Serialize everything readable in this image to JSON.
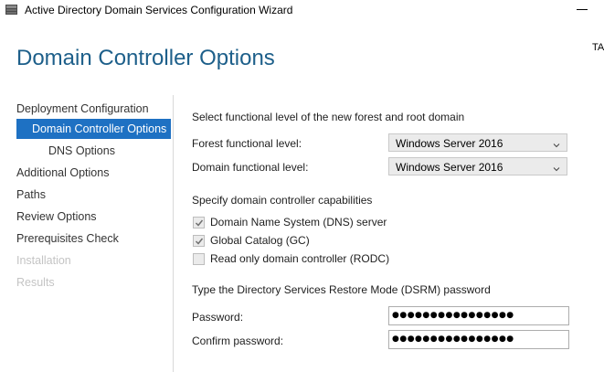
{
  "window": {
    "title": "Active Directory Domain Services Configuration Wizard",
    "target_server": "TA"
  },
  "page": {
    "title": "Domain Controller Options"
  },
  "nav": {
    "items": [
      {
        "label": "Deployment Configuration",
        "state": "normal"
      },
      {
        "label": "Domain Controller Options",
        "state": "selected"
      },
      {
        "label": "DNS Options",
        "state": "normal"
      },
      {
        "label": "Additional Options",
        "state": "normal"
      },
      {
        "label": "Paths",
        "state": "normal"
      },
      {
        "label": "Review Options",
        "state": "normal"
      },
      {
        "label": "Prerequisites Check",
        "state": "normal"
      },
      {
        "label": "Installation",
        "state": "disabled"
      },
      {
        "label": "Results",
        "state": "disabled"
      }
    ]
  },
  "functional_level": {
    "heading": "Select functional level of the new forest and root domain",
    "forest_label": "Forest functional level:",
    "forest_value": "Windows Server 2016",
    "domain_label": "Domain functional level:",
    "domain_value": "Windows Server 2016"
  },
  "capabilities": {
    "heading": "Specify domain controller capabilities",
    "dns": {
      "label": "Domain Name System (DNS) server",
      "checked": true
    },
    "gc": {
      "label": "Global Catalog (GC)",
      "checked": true
    },
    "rodc": {
      "label": "Read only domain controller (RODC)",
      "checked": false
    }
  },
  "dsrm": {
    "heading": "Type the Directory Services Restore Mode (DSRM) password",
    "password_label": "Password:",
    "password_value": "●●●●●●●●●●●●●●●●",
    "confirm_label": "Confirm password:",
    "confirm_value": "●●●●●●●●●●●●●●●●"
  },
  "colors": {
    "title_blue": "#1d5f8a",
    "nav_selected": "#1e71c3",
    "disabled_text": "#c4c4c4"
  },
  "icons": {
    "app": "server-manager-icon",
    "select": "chevron-down-icon",
    "check": "checkmark-icon"
  }
}
